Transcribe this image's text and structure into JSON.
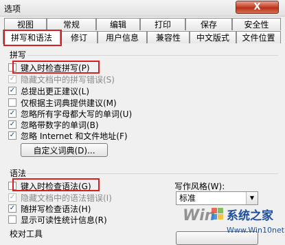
{
  "window": {
    "title": "选项",
    "close_label": "X"
  },
  "tabs_row1": [
    "视图",
    "常规",
    "编辑",
    "打印",
    "保存",
    "安全性"
  ],
  "tabs_row2": [
    "拼写和语法",
    "修订",
    "用户信息",
    "兼容性",
    "中文版式",
    "文件位置"
  ],
  "spelling": {
    "heading": "拼写",
    "options": [
      {
        "label": "键入时检查拼写(P)",
        "checked": false,
        "disabled": false
      },
      {
        "label": "隐藏文档中的拼写错误(S)",
        "checked": true,
        "disabled": true
      },
      {
        "label": "总提出更正建议(L)",
        "checked": true,
        "disabled": false
      },
      {
        "label": "仅根据主词典提供建议(M)",
        "checked": false,
        "disabled": false
      },
      {
        "label": "忽略所有字母都大写的单词(U)",
        "checked": true,
        "disabled": false
      },
      {
        "label": "忽略带数字的单词(B)",
        "checked": true,
        "disabled": false
      },
      {
        "label": "忽略 Internet 和文件地址(F)",
        "checked": true,
        "disabled": false
      }
    ],
    "custom_dict_button": "自定义词典(D)..."
  },
  "grammar": {
    "heading": "语法",
    "options": [
      {
        "label": "键入时检查语法(G)",
        "checked": false,
        "disabled": false
      },
      {
        "label": "隐藏文档中的语法错误(I)",
        "checked": true,
        "disabled": true
      },
      {
        "label": "随拼写检查语法(H)",
        "checked": true,
        "disabled": false
      },
      {
        "label": "显示可读性统计信息(R)",
        "checked": false,
        "disabled": false
      }
    ],
    "writing_style_label": "写作风格(W):",
    "writing_style_value": "标准"
  },
  "proofing": {
    "heading": "校对工具"
  },
  "watermark": {
    "brand": "Win7系统之家",
    "url": "Www.Win10net.com"
  },
  "colors": {
    "highlight": "#d42020",
    "close": "#c8462f"
  }
}
